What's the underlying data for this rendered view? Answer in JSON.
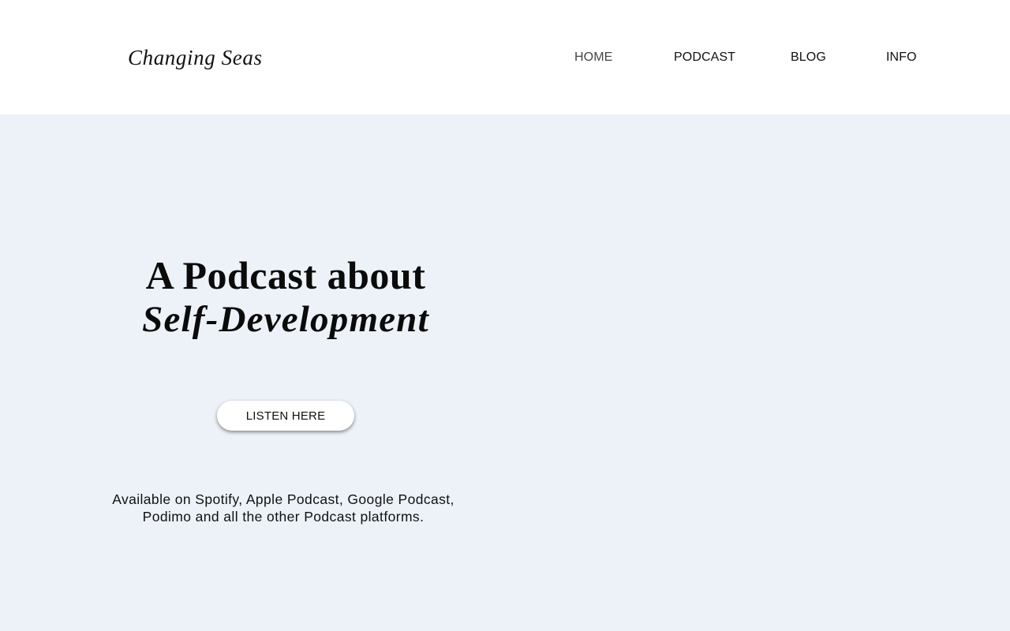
{
  "header": {
    "site_title": "Changing Seas",
    "nav": [
      {
        "label": "HOME",
        "active": true
      },
      {
        "label": "PODCAST",
        "active": false
      },
      {
        "label": "BLOG",
        "active": false
      },
      {
        "label": "INFO",
        "active": false
      }
    ]
  },
  "hero": {
    "title_line1": "A Podcast about",
    "title_line2": "Self-Development",
    "cta_label": "LISTEN HERE",
    "availability_text": "Available on Spotify, Apple Podcast, Google Podcast, Podimo and all the other Podcast platforms."
  },
  "colors": {
    "hero_background": "#ecf2f8",
    "header_background": "#ffffff",
    "text": "#111111"
  }
}
